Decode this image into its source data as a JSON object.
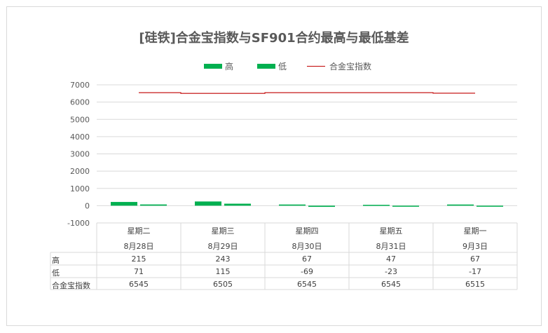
{
  "chart_data": {
    "type": "bar",
    "title": "[硅铁]合金宝指数与SF901合约最高与最低基差",
    "categories": [
      [
        "星期二",
        "8月28日"
      ],
      [
        "星期三",
        "8月29日"
      ],
      [
        "星期四",
        "8月30日"
      ],
      [
        "星期五",
        "8月31日"
      ],
      [
        "星期一",
        "9月3日"
      ]
    ],
    "series": [
      {
        "name": "高",
        "type": "bar",
        "color": "#00b050",
        "values": [
          215,
          243,
          67,
          47,
          67
        ]
      },
      {
        "name": "低",
        "type": "bar",
        "color": "#00b050",
        "values": [
          71,
          115,
          -69,
          -23,
          -17
        ]
      },
      {
        "name": "合金宝指数",
        "type": "line",
        "color": "#c00000",
        "values": [
          6545,
          6505,
          6545,
          6545,
          6515
        ]
      }
    ],
    "ylim": [
      -1000,
      7000
    ],
    "yticks": [
      7000,
      6000,
      5000,
      4000,
      3000,
      2000,
      1000,
      0,
      -1000
    ],
    "grid": true,
    "legend_position": "top",
    "data_table": true
  }
}
